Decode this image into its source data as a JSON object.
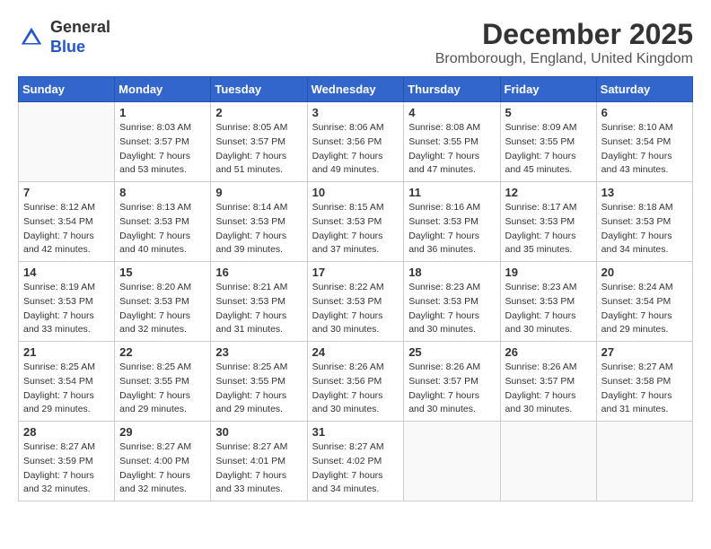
{
  "header": {
    "logo_general": "General",
    "logo_blue": "Blue",
    "month_year": "December 2025",
    "location": "Bromborough, England, United Kingdom"
  },
  "calendar": {
    "days_of_week": [
      "Sunday",
      "Monday",
      "Tuesday",
      "Wednesday",
      "Thursday",
      "Friday",
      "Saturday"
    ],
    "weeks": [
      [
        {
          "day": "",
          "info": ""
        },
        {
          "day": "1",
          "info": "Sunrise: 8:03 AM\nSunset: 3:57 PM\nDaylight: 7 hours\nand 53 minutes."
        },
        {
          "day": "2",
          "info": "Sunrise: 8:05 AM\nSunset: 3:57 PM\nDaylight: 7 hours\nand 51 minutes."
        },
        {
          "day": "3",
          "info": "Sunrise: 8:06 AM\nSunset: 3:56 PM\nDaylight: 7 hours\nand 49 minutes."
        },
        {
          "day": "4",
          "info": "Sunrise: 8:08 AM\nSunset: 3:55 PM\nDaylight: 7 hours\nand 47 minutes."
        },
        {
          "day": "5",
          "info": "Sunrise: 8:09 AM\nSunset: 3:55 PM\nDaylight: 7 hours\nand 45 minutes."
        },
        {
          "day": "6",
          "info": "Sunrise: 8:10 AM\nSunset: 3:54 PM\nDaylight: 7 hours\nand 43 minutes."
        }
      ],
      [
        {
          "day": "7",
          "info": "Sunrise: 8:12 AM\nSunset: 3:54 PM\nDaylight: 7 hours\nand 42 minutes."
        },
        {
          "day": "8",
          "info": "Sunrise: 8:13 AM\nSunset: 3:53 PM\nDaylight: 7 hours\nand 40 minutes."
        },
        {
          "day": "9",
          "info": "Sunrise: 8:14 AM\nSunset: 3:53 PM\nDaylight: 7 hours\nand 39 minutes."
        },
        {
          "day": "10",
          "info": "Sunrise: 8:15 AM\nSunset: 3:53 PM\nDaylight: 7 hours\nand 37 minutes."
        },
        {
          "day": "11",
          "info": "Sunrise: 8:16 AM\nSunset: 3:53 PM\nDaylight: 7 hours\nand 36 minutes."
        },
        {
          "day": "12",
          "info": "Sunrise: 8:17 AM\nSunset: 3:53 PM\nDaylight: 7 hours\nand 35 minutes."
        },
        {
          "day": "13",
          "info": "Sunrise: 8:18 AM\nSunset: 3:53 PM\nDaylight: 7 hours\nand 34 minutes."
        }
      ],
      [
        {
          "day": "14",
          "info": "Sunrise: 8:19 AM\nSunset: 3:53 PM\nDaylight: 7 hours\nand 33 minutes."
        },
        {
          "day": "15",
          "info": "Sunrise: 8:20 AM\nSunset: 3:53 PM\nDaylight: 7 hours\nand 32 minutes."
        },
        {
          "day": "16",
          "info": "Sunrise: 8:21 AM\nSunset: 3:53 PM\nDaylight: 7 hours\nand 31 minutes."
        },
        {
          "day": "17",
          "info": "Sunrise: 8:22 AM\nSunset: 3:53 PM\nDaylight: 7 hours\nand 30 minutes."
        },
        {
          "day": "18",
          "info": "Sunrise: 8:23 AM\nSunset: 3:53 PM\nDaylight: 7 hours\nand 30 minutes."
        },
        {
          "day": "19",
          "info": "Sunrise: 8:23 AM\nSunset: 3:53 PM\nDaylight: 7 hours\nand 30 minutes."
        },
        {
          "day": "20",
          "info": "Sunrise: 8:24 AM\nSunset: 3:54 PM\nDaylight: 7 hours\nand 29 minutes."
        }
      ],
      [
        {
          "day": "21",
          "info": "Sunrise: 8:25 AM\nSunset: 3:54 PM\nDaylight: 7 hours\nand 29 minutes."
        },
        {
          "day": "22",
          "info": "Sunrise: 8:25 AM\nSunset: 3:55 PM\nDaylight: 7 hours\nand 29 minutes."
        },
        {
          "day": "23",
          "info": "Sunrise: 8:25 AM\nSunset: 3:55 PM\nDaylight: 7 hours\nand 29 minutes."
        },
        {
          "day": "24",
          "info": "Sunrise: 8:26 AM\nSunset: 3:56 PM\nDaylight: 7 hours\nand 30 minutes."
        },
        {
          "day": "25",
          "info": "Sunrise: 8:26 AM\nSunset: 3:57 PM\nDaylight: 7 hours\nand 30 minutes."
        },
        {
          "day": "26",
          "info": "Sunrise: 8:26 AM\nSunset: 3:57 PM\nDaylight: 7 hours\nand 30 minutes."
        },
        {
          "day": "27",
          "info": "Sunrise: 8:27 AM\nSunset: 3:58 PM\nDaylight: 7 hours\nand 31 minutes."
        }
      ],
      [
        {
          "day": "28",
          "info": "Sunrise: 8:27 AM\nSunset: 3:59 PM\nDaylight: 7 hours\nand 32 minutes."
        },
        {
          "day": "29",
          "info": "Sunrise: 8:27 AM\nSunset: 4:00 PM\nDaylight: 7 hours\nand 32 minutes."
        },
        {
          "day": "30",
          "info": "Sunrise: 8:27 AM\nSunset: 4:01 PM\nDaylight: 7 hours\nand 33 minutes."
        },
        {
          "day": "31",
          "info": "Sunrise: 8:27 AM\nSunset: 4:02 PM\nDaylight: 7 hours\nand 34 minutes."
        },
        {
          "day": "",
          "info": ""
        },
        {
          "day": "",
          "info": ""
        },
        {
          "day": "",
          "info": ""
        }
      ]
    ]
  }
}
